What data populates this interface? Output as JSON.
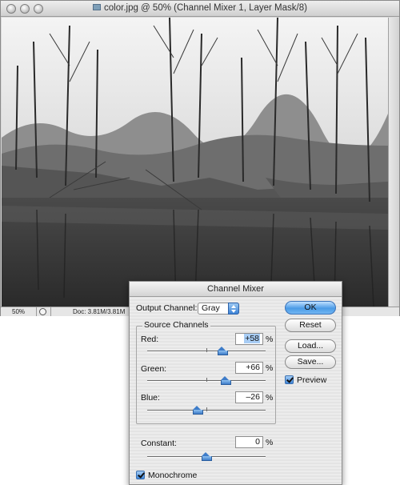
{
  "document": {
    "title": "color.jpg @ 50% (Channel Mixer 1, Layer Mask/8)",
    "status": {
      "zoom": "50%",
      "doc_info": "Doc: 3.81M/3.81M"
    }
  },
  "dialog": {
    "title": "Channel Mixer",
    "output_channel_label": "Output Channel:",
    "output_channel_value": "Gray",
    "source_channels_label": "Source Channels",
    "channels": [
      {
        "label": "Red:",
        "value": "+58",
        "slider_percent": 58
      },
      {
        "label": "Green:",
        "value": "+66",
        "slider_percent": 66
      },
      {
        "label": "Blue:",
        "value": "–26",
        "slider_percent": -26
      }
    ],
    "constant_label": "Constant:",
    "constant_value": "0",
    "constant_slider_percent": 0,
    "percent_sign": "%",
    "monochrome_label": "Monochrome",
    "monochrome_checked": true,
    "preview_label": "Preview",
    "preview_checked": true,
    "buttons": {
      "ok": "OK",
      "reset": "Reset",
      "load": "Load...",
      "save": "Save..."
    }
  },
  "colors": {
    "accent": "#3f86d8"
  }
}
